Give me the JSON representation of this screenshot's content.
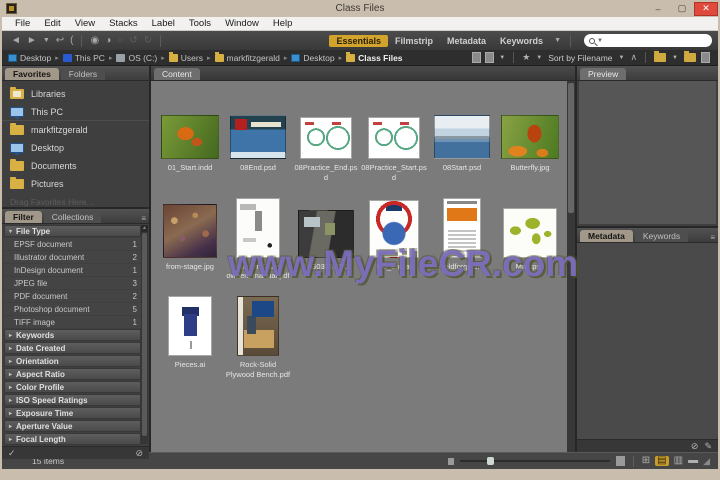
{
  "window": {
    "title": "Class Files"
  },
  "icons": {
    "back": "◄",
    "forward": "►",
    "dropdown": "▼",
    "return": "↩",
    "paren": "(",
    "camera": "◉",
    "refine": "◑",
    "raw": "○",
    "rotate_ccw": "↺",
    "rotate_cw": "↻",
    "star": "★",
    "ascending": "∧",
    "crumb_sep": "▸",
    "collapsed": "▸",
    "expanded": "▾",
    "check": "✓",
    "no": "⊘",
    "pencil": "✎",
    "menu": "≡",
    "grid_view": "⊞",
    "thumb_view": "▤",
    "detail_view": "▥",
    "list_view": "▬",
    "grip": "◢",
    "minimize": "–",
    "maximize": "▢",
    "close": "✕"
  },
  "menu_bar": {
    "items": [
      "File",
      "Edit",
      "View",
      "Stacks",
      "Label",
      "Tools",
      "Window",
      "Help"
    ]
  },
  "workspace": {
    "tabs": [
      {
        "label": "Essentials",
        "active": true
      },
      {
        "label": "Filmstrip",
        "active": false
      },
      {
        "label": "Metadata",
        "active": false
      },
      {
        "label": "Keywords",
        "active": false
      }
    ]
  },
  "breadcrumb": {
    "items": [
      "Desktop",
      "This PC",
      "OS (C:)",
      "Users",
      "markfitzgerald",
      "Desktop",
      "Class Files"
    ]
  },
  "view_bar": {
    "sort_label": "Sort by Filename"
  },
  "favorites": {
    "tabs": [
      "Favorites",
      "Folders"
    ],
    "items": [
      "Libraries",
      "This PC",
      "markfitzgerald",
      "Desktop",
      "Documents",
      "Pictures"
    ],
    "hint": "Drag Favorites Here..."
  },
  "filter": {
    "tabs": [
      "Filter",
      "Collections"
    ],
    "file_type": {
      "label": "File Type",
      "rows": [
        {
          "label": "EPSF document",
          "count": "1"
        },
        {
          "label": "Illustrator document",
          "count": "2"
        },
        {
          "label": "InDesign document",
          "count": "1"
        },
        {
          "label": "JPEG file",
          "count": "3"
        },
        {
          "label": "PDF document",
          "count": "2"
        },
        {
          "label": "Photoshop document",
          "count": "5"
        },
        {
          "label": "TIFF image",
          "count": "1"
        }
      ]
    },
    "collapsed_sections": [
      "Keywords",
      "Date Created",
      "Orientation",
      "Aspect Ratio",
      "Color Profile",
      "ISO Speed Ratings",
      "Exposure Time",
      "Aperture Value",
      "Focal Length"
    ]
  },
  "content": {
    "tab": "Content",
    "files": [
      {
        "name": "01_Start.indd"
      },
      {
        "name": "08End.psd"
      },
      {
        "name": "08Practice_End.psd"
      },
      {
        "name": "08Practice_Start.psd"
      },
      {
        "name": "08Start.psd"
      },
      {
        "name": "Butterfly.jpg"
      },
      {
        "name": "from-stage.jpg"
      },
      {
        "name": "Hoover Savvy owners manual.pdf"
      },
      {
        "name": "IMG0373.JPG"
      },
      {
        "name": "t00_end.ai"
      },
      {
        "name": "oldforge.tif"
      },
      {
        "name": "Map.psd"
      },
      {
        "name": "Pieces.ai"
      },
      {
        "name": "Rock-Solid Plywood Bench.pdf"
      }
    ]
  },
  "preview": {
    "tab": "Preview"
  },
  "metadata": {
    "tabs": [
      "Metadata",
      "Keywords"
    ]
  },
  "status_bar": {
    "item_count": "15 items"
  },
  "watermark": {
    "text": "www.MyFileCR.com"
  },
  "colors": {
    "accent": "#d2a42c",
    "close_button": "#e04a3c",
    "titlebar": "#c9bdad",
    "watermark": "#8071cd"
  }
}
